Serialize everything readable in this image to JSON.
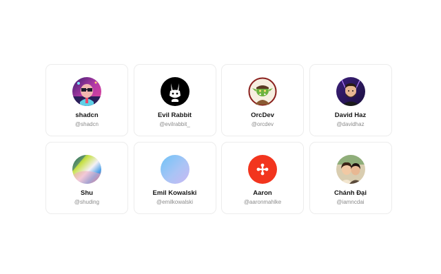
{
  "users": [
    {
      "name": "shadcn",
      "handle": "@shadcn",
      "avatar_icon": "shadcn-avatar-icon"
    },
    {
      "name": "Evil Rabbit",
      "handle": "@evilrabbit_",
      "avatar_icon": "rabbit-avatar-icon"
    },
    {
      "name": "OrcDev",
      "handle": "@orcdev",
      "avatar_icon": "orc-avatar-icon"
    },
    {
      "name": "David Haz",
      "handle": "@davidhaz",
      "avatar_icon": "david-avatar-icon"
    },
    {
      "name": "Shu",
      "handle": "@shuding",
      "avatar_icon": "gradient-avatar-icon"
    },
    {
      "name": "Emil Kowalski",
      "handle": "@emilkowalski",
      "avatar_icon": "blue-gradient-avatar-icon"
    },
    {
      "name": "Aaron",
      "handle": "@aaronmahlke",
      "avatar_icon": "red-logo-avatar-icon"
    },
    {
      "name": "Chánh Đại",
      "handle": "@iamncdai",
      "avatar_icon": "couple-avatar-icon"
    }
  ],
  "colors": {
    "card_border": "#ececec",
    "name_text": "#161616",
    "handle_text": "#8a8a8a",
    "aaron_red": "#f2351e"
  }
}
